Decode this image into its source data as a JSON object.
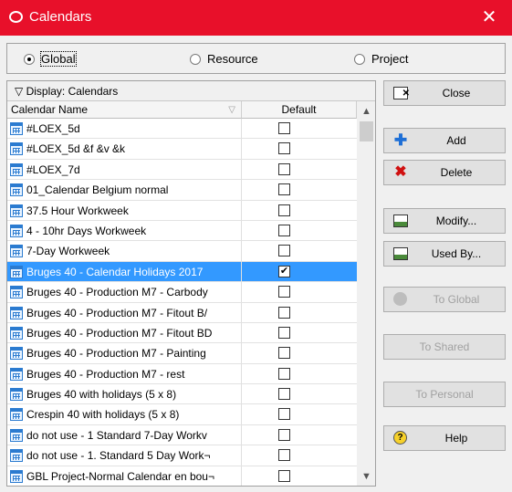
{
  "window": {
    "title": "Calendars"
  },
  "scope": {
    "options": [
      {
        "label": "Global",
        "selected": true
      },
      {
        "label": "Resource",
        "selected": false
      },
      {
        "label": "Project",
        "selected": false
      }
    ]
  },
  "list": {
    "display_label": "Display: Calendars",
    "columns": {
      "name": "Calendar Name",
      "default": "Default"
    },
    "rows": [
      {
        "name": "#LOEX_5d",
        "default": false
      },
      {
        "name": "#LOEX_5d &f &v &k",
        "default": false
      },
      {
        "name": "#LOEX_7d",
        "default": false
      },
      {
        "name": "01_Calendar Belgium normal",
        "default": false
      },
      {
        "name": "37.5 Hour Workweek",
        "default": false
      },
      {
        "name": "4 - 10hr Days Workweek",
        "default": false
      },
      {
        "name": "7-Day Workweek",
        "default": false
      },
      {
        "name": "Bruges 40 - Calendar Holidays 2017",
        "default": true,
        "selected": true
      },
      {
        "name": "Bruges 40 - Production M7 - Carbody",
        "default": false
      },
      {
        "name": "Bruges 40 - Production M7 - Fitout B/",
        "default": false
      },
      {
        "name": "Bruges 40 - Production M7 - Fitout BD",
        "default": false
      },
      {
        "name": "Bruges 40 - Production M7 - Painting",
        "default": false
      },
      {
        "name": "Bruges 40 - Production M7 - rest",
        "default": false
      },
      {
        "name": "Bruges 40 with holidays (5 x 8)",
        "default": false
      },
      {
        "name": "Crespin 40 with holidays (5 x 8)",
        "default": false
      },
      {
        "name": "do not use - 1 Standard 7-Day Workv",
        "default": false
      },
      {
        "name": "do not use - 1. Standard 5 Day Work¬",
        "default": false
      },
      {
        "name": "GBL Project-Normal Calendar en bou¬",
        "default": false
      }
    ]
  },
  "buttons": {
    "close": "Close",
    "add": "Add",
    "delete": "Delete",
    "modify": "Modify...",
    "used_by": "Used By...",
    "to_global": "To Global",
    "to_shared": "To Shared",
    "to_personal": "To Personal",
    "help": "Help"
  },
  "colors": {
    "titlebar": "#e8102a",
    "selection": "#3399ff"
  }
}
